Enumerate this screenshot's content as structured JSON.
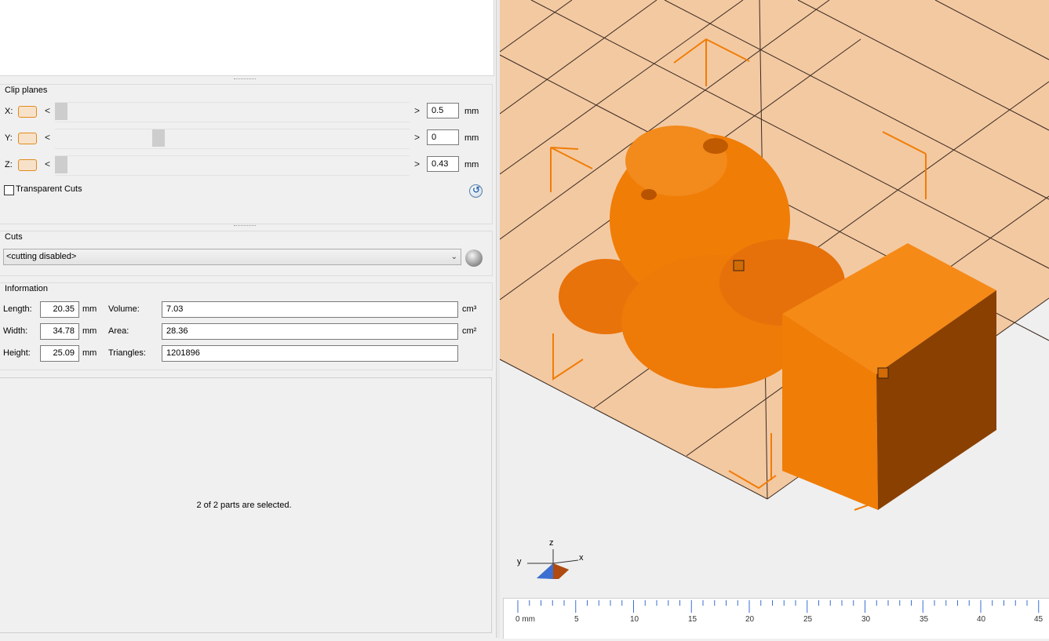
{
  "clip_planes": {
    "title": "Clip planes",
    "unit": "mm",
    "x": {
      "axis": "X:",
      "value": "0.5",
      "slider_fraction": 0.0
    },
    "y": {
      "axis": "Y:",
      "value": "0",
      "slider_fraction": 0.29
    },
    "z": {
      "axis": "Z:",
      "value": "0.43",
      "slider_fraction": 0.0
    },
    "transparent_cuts_label": "Transparent Cuts",
    "transparent_cuts_checked": false,
    "left_arrow": "<",
    "right_arrow": ">"
  },
  "cuts": {
    "title": "Cuts",
    "selected": "<cutting disabled>"
  },
  "information": {
    "title": "Information",
    "length_label": "Length:",
    "length_value": "20.35",
    "width_label": "Width:",
    "width_value": "34.78",
    "height_label": "Height:",
    "height_value": "25.09",
    "dim_unit": "mm",
    "volume_label": "Volume:",
    "volume_value": "7.03",
    "volume_unit": "cm³",
    "area_label": "Area:",
    "area_value": "28.36",
    "area_unit": "cm²",
    "triangles_label": "Triangles:",
    "triangles_value": "1201896"
  },
  "selection_status": "2 of 2 parts are selected.",
  "axes_gizmo": {
    "x": "x",
    "y": "y",
    "z": "z"
  },
  "ruler": {
    "labels": [
      "0 mm",
      "5",
      "10",
      "15",
      "20",
      "25",
      "30",
      "35",
      "40",
      "45"
    ]
  },
  "colors": {
    "model_orange": "#f07d06",
    "bed": "#f3c9a2",
    "accent": "#e38a1f"
  }
}
